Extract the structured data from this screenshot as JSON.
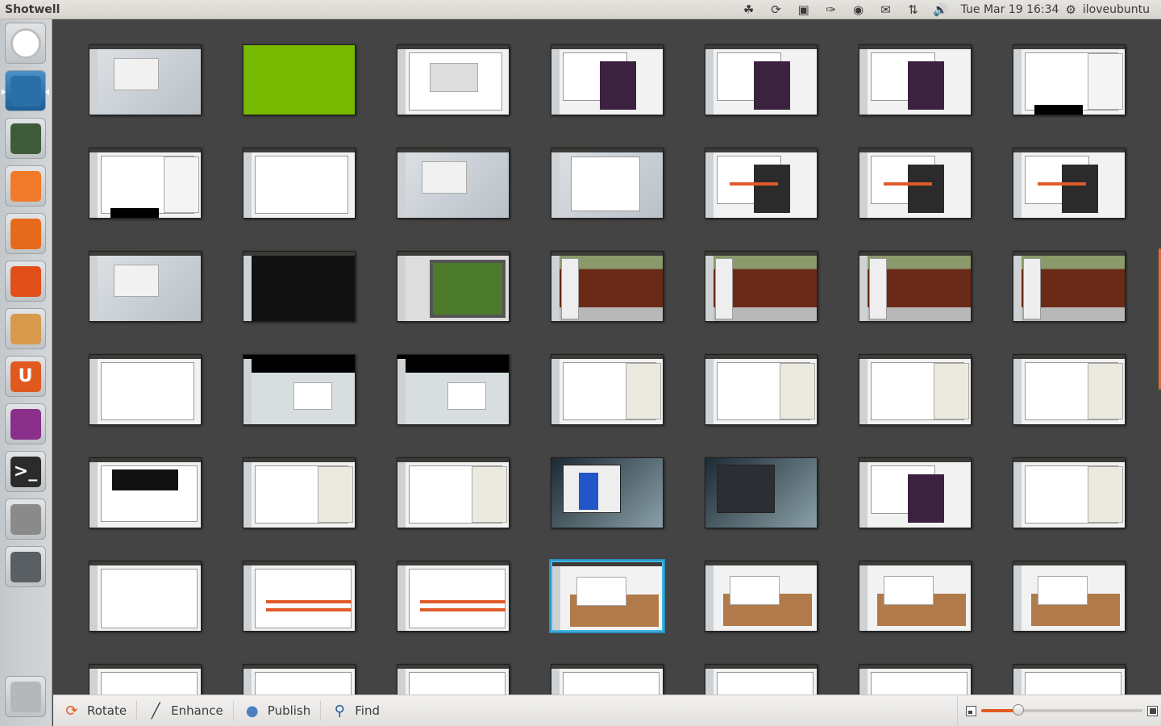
{
  "top_panel": {
    "app_title": "Shotwell",
    "clock": "Tue Mar 19  16:34",
    "user": "iloveubuntu",
    "indicators": [
      "evernote-icon",
      "sync-icon",
      "display-icon",
      "attachment-icon",
      "eye-icon",
      "mail-icon",
      "network-icon",
      "volume-icon"
    ]
  },
  "launcher": {
    "items": [
      {
        "name": "dash-home",
        "icon": "ubuntu-logo-icon",
        "color": "#d9d9d9"
      },
      {
        "name": "shotwell",
        "icon": "shotwell-icon",
        "color": "#2a6fa8",
        "active": true
      },
      {
        "name": "installer",
        "icon": "download-terminal-icon",
        "color": "#3f5b3a"
      },
      {
        "name": "files",
        "icon": "folder-icon",
        "color": "#f07a2a"
      },
      {
        "name": "firefox",
        "icon": "firefox-icon",
        "color": "#e66a1b"
      },
      {
        "name": "software-center",
        "icon": "shopping-bag-icon",
        "color": "#e04f1a"
      },
      {
        "name": "archive",
        "icon": "package-icon",
        "color": "#d79a4c"
      },
      {
        "name": "ubuntu-one",
        "icon": "ubuntu-one-icon",
        "color": "#e05a20",
        "glyph": "U"
      },
      {
        "name": "cheese",
        "icon": "webcam-icon",
        "color": "#8a2f8a"
      },
      {
        "name": "terminal",
        "icon": "terminal-icon",
        "color": "#2b2b2b",
        "glyph": ">_"
      },
      {
        "name": "screenshot",
        "icon": "camera-icon",
        "color": "#8a8a8a"
      },
      {
        "name": "workspace-switcher",
        "icon": "workspace-icon",
        "color": "#5a5f64"
      },
      {
        "name": "trash",
        "icon": "trash-icon",
        "color": "#b5b8ba"
      }
    ]
  },
  "photos": {
    "selected_index": 38,
    "items": [
      {
        "style": "desktop"
      },
      {
        "style": "green"
      },
      {
        "style": "dialog"
      },
      {
        "style": "purple"
      },
      {
        "style": "purple"
      },
      {
        "style": "purple"
      },
      {
        "style": "docblack"
      },
      {
        "style": "docblack"
      },
      {
        "style": "filelist"
      },
      {
        "style": "desktop"
      },
      {
        "style": "weather"
      },
      {
        "style": "darkorange"
      },
      {
        "style": "darkorange"
      },
      {
        "style": "darkorange"
      },
      {
        "style": "desktop"
      },
      {
        "style": "black"
      },
      {
        "style": "track"
      },
      {
        "style": "fence"
      },
      {
        "style": "fence"
      },
      {
        "style": "fence"
      },
      {
        "style": "fence"
      },
      {
        "style": "white"
      },
      {
        "style": "blackbar"
      },
      {
        "style": "blackbar"
      },
      {
        "style": "settings"
      },
      {
        "style": "settings"
      },
      {
        "style": "settings"
      },
      {
        "style": "settings"
      },
      {
        "style": "media"
      },
      {
        "style": "editor"
      },
      {
        "style": "editor"
      },
      {
        "style": "chart"
      },
      {
        "style": "darkapp"
      },
      {
        "style": "purple"
      },
      {
        "style": "article"
      },
      {
        "style": "code"
      },
      {
        "style": "codeorange"
      },
      {
        "style": "codeorange"
      },
      {
        "style": "floor"
      },
      {
        "style": "floor"
      },
      {
        "style": "floor"
      },
      {
        "style": "floor"
      },
      {
        "style": "code"
      },
      {
        "style": "code"
      },
      {
        "style": "code"
      },
      {
        "style": "code"
      },
      {
        "style": "code"
      },
      {
        "style": "code"
      },
      {
        "style": "code"
      }
    ]
  },
  "toolbar": {
    "rotate_label": "Rotate",
    "enhance_label": "Enhance",
    "publish_label": "Publish",
    "find_label": "Find",
    "zoom_level": 0.23
  }
}
